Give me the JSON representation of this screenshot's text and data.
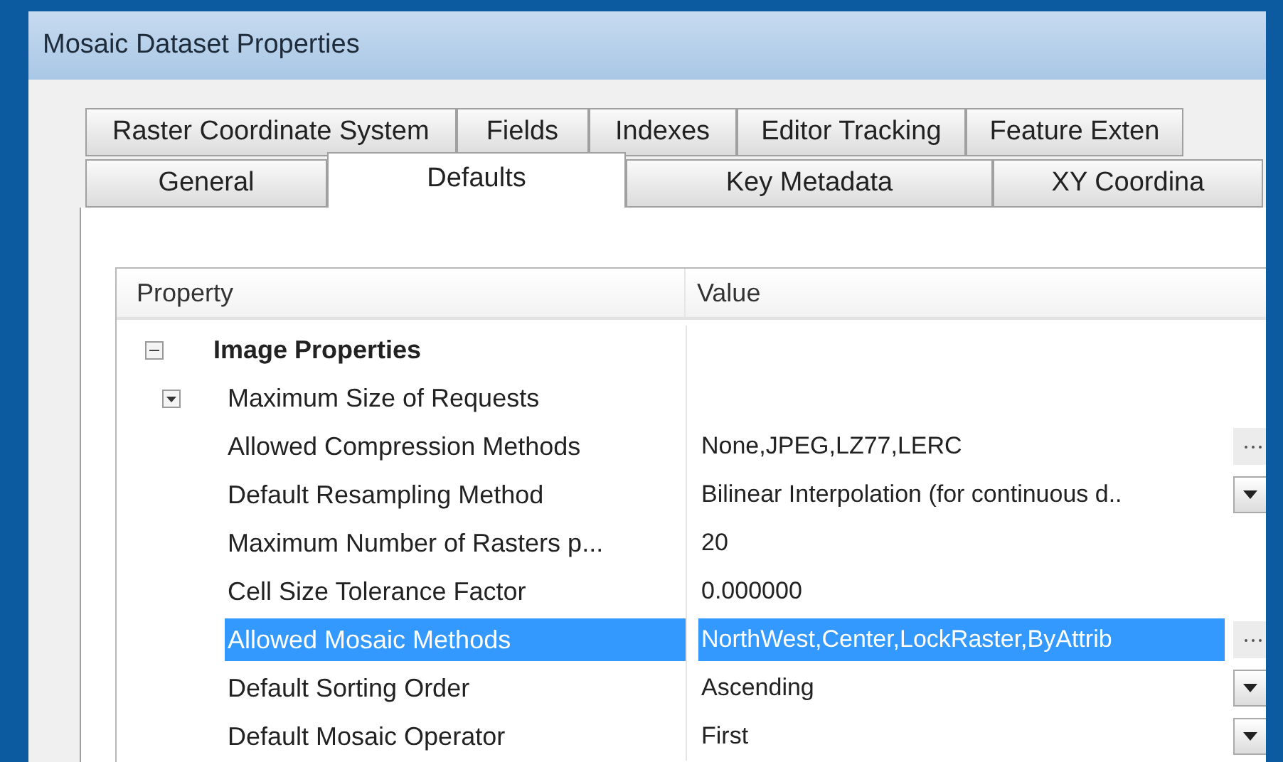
{
  "window": {
    "title": "Mosaic Dataset Properties"
  },
  "tab_rows": [
    [
      {
        "label": "Raster Coordinate System",
        "selected": false
      },
      {
        "label": "Fields",
        "selected": false
      },
      {
        "label": "Indexes",
        "selected": false
      },
      {
        "label": "Editor Tracking",
        "selected": false
      },
      {
        "label": "Feature Exten",
        "selected": false
      }
    ],
    [
      {
        "label": "General",
        "selected": false
      },
      {
        "label": "Defaults",
        "selected": true
      },
      {
        "label": "Key Metadata",
        "selected": false
      },
      {
        "label": "XY Coordina",
        "selected": false
      }
    ]
  ],
  "grid": {
    "columns": [
      "Property",
      "Value"
    ],
    "rows": [
      {
        "kind": "group",
        "expanded": true,
        "property": "Image Properties",
        "selected": false
      },
      {
        "kind": "subgroup",
        "expanded": false,
        "property": "Maximum Size of Requests",
        "selected": false
      },
      {
        "kind": "ellipsis",
        "property": "Allowed Compression Methods",
        "value": "None,JPEG,LZ77,LERC",
        "selected": false
      },
      {
        "kind": "dropdown",
        "property": "Default Resampling Method",
        "value": "Bilinear Interpolation (for continuous d..",
        "selected": false
      },
      {
        "kind": "text",
        "property": "Maximum Number of Rasters p...",
        "value": "20",
        "selected": false
      },
      {
        "kind": "text",
        "property": "Cell Size Tolerance Factor",
        "value": "0.000000",
        "selected": false
      },
      {
        "kind": "ellipsis",
        "property": "Allowed Mosaic Methods",
        "value": "NorthWest,Center,LockRaster,ByAttrib",
        "selected": true
      },
      {
        "kind": "dropdown",
        "property": "Default Sorting Order",
        "value": "Ascending",
        "selected": false
      },
      {
        "kind": "dropdown",
        "property": "Default Mosaic Operator",
        "value": "First",
        "selected": false
      }
    ]
  }
}
